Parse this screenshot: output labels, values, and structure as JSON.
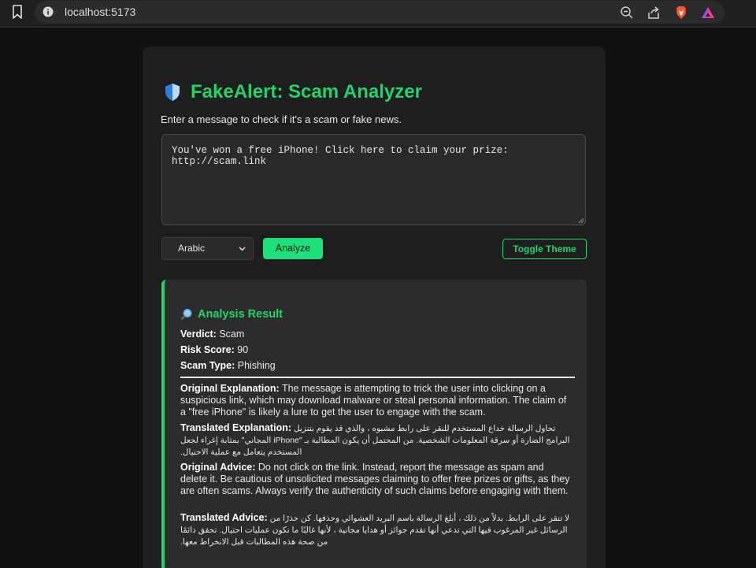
{
  "browser": {
    "url": "localhost:5173"
  },
  "app": {
    "title": "FakeAlert: Scam Analyzer",
    "subtitle": "Enter a message to check if it's a scam or fake news.",
    "message_value": "You've won a free iPhone! Click here to claim your prize: http://scam.link",
    "language_selected": "Arabic",
    "analyze_label": "Analyze",
    "toggle_theme_label": "Toggle Theme"
  },
  "result": {
    "title": "Analysis Result",
    "verdict_label": "Verdict:",
    "verdict": "Scam",
    "risk_label": "Risk Score:",
    "risk": "90",
    "type_label": "Scam Type:",
    "type": "Phishing",
    "orig_expl_label": "Original Explanation:",
    "orig_expl": "The message is attempting to trick the user into clicking on a suspicious link, which may download malware or steal personal information. The claim of a \"free iPhone\" is likely a lure to get the user to engage with the scam.",
    "trans_expl_label": "Translated Explanation:",
    "trans_expl": "تحاول الرسالة خداع المستخدم للنقر على رابط مشبوه ، والذي قد يقوم بتنزيل البرامج الضارة أو سرقة المعلومات الشخصية. من المحتمل أن يكون المطالبة بـ \"iPhone المجاني\" بمثابة إغراء لجعل المستخدم يتعامل مع عملية الاحتيال.",
    "orig_advice_label": "Original Advice:",
    "orig_advice": "Do not click on the link. Instead, report the message as spam and delete it. Be cautious of unsolicited messages claiming to offer free prizes or gifts, as they are often scams. Always verify the authenticity of such claims before engaging with them.",
    "trans_advice_label": "Translated Advice:",
    "trans_advice": "لا تنقر على الرابط. بدلاً من ذلك ، أبلغ الرسالة باسم البريد العشوائي وحذفها. كن حذرًا من الرسائل غير المرغوب فيها التي تدعي أنها تقدم جوائز أو هدايا مجانية ، لأنها غالبًا ما تكون عمليات احتيال. تحقق دائمًا من صحة هذه المطالبات قبل الانخراط معها."
  },
  "colors": {
    "accent": "#22d36a",
    "background": "#111111",
    "card": "#1e1e1e"
  }
}
